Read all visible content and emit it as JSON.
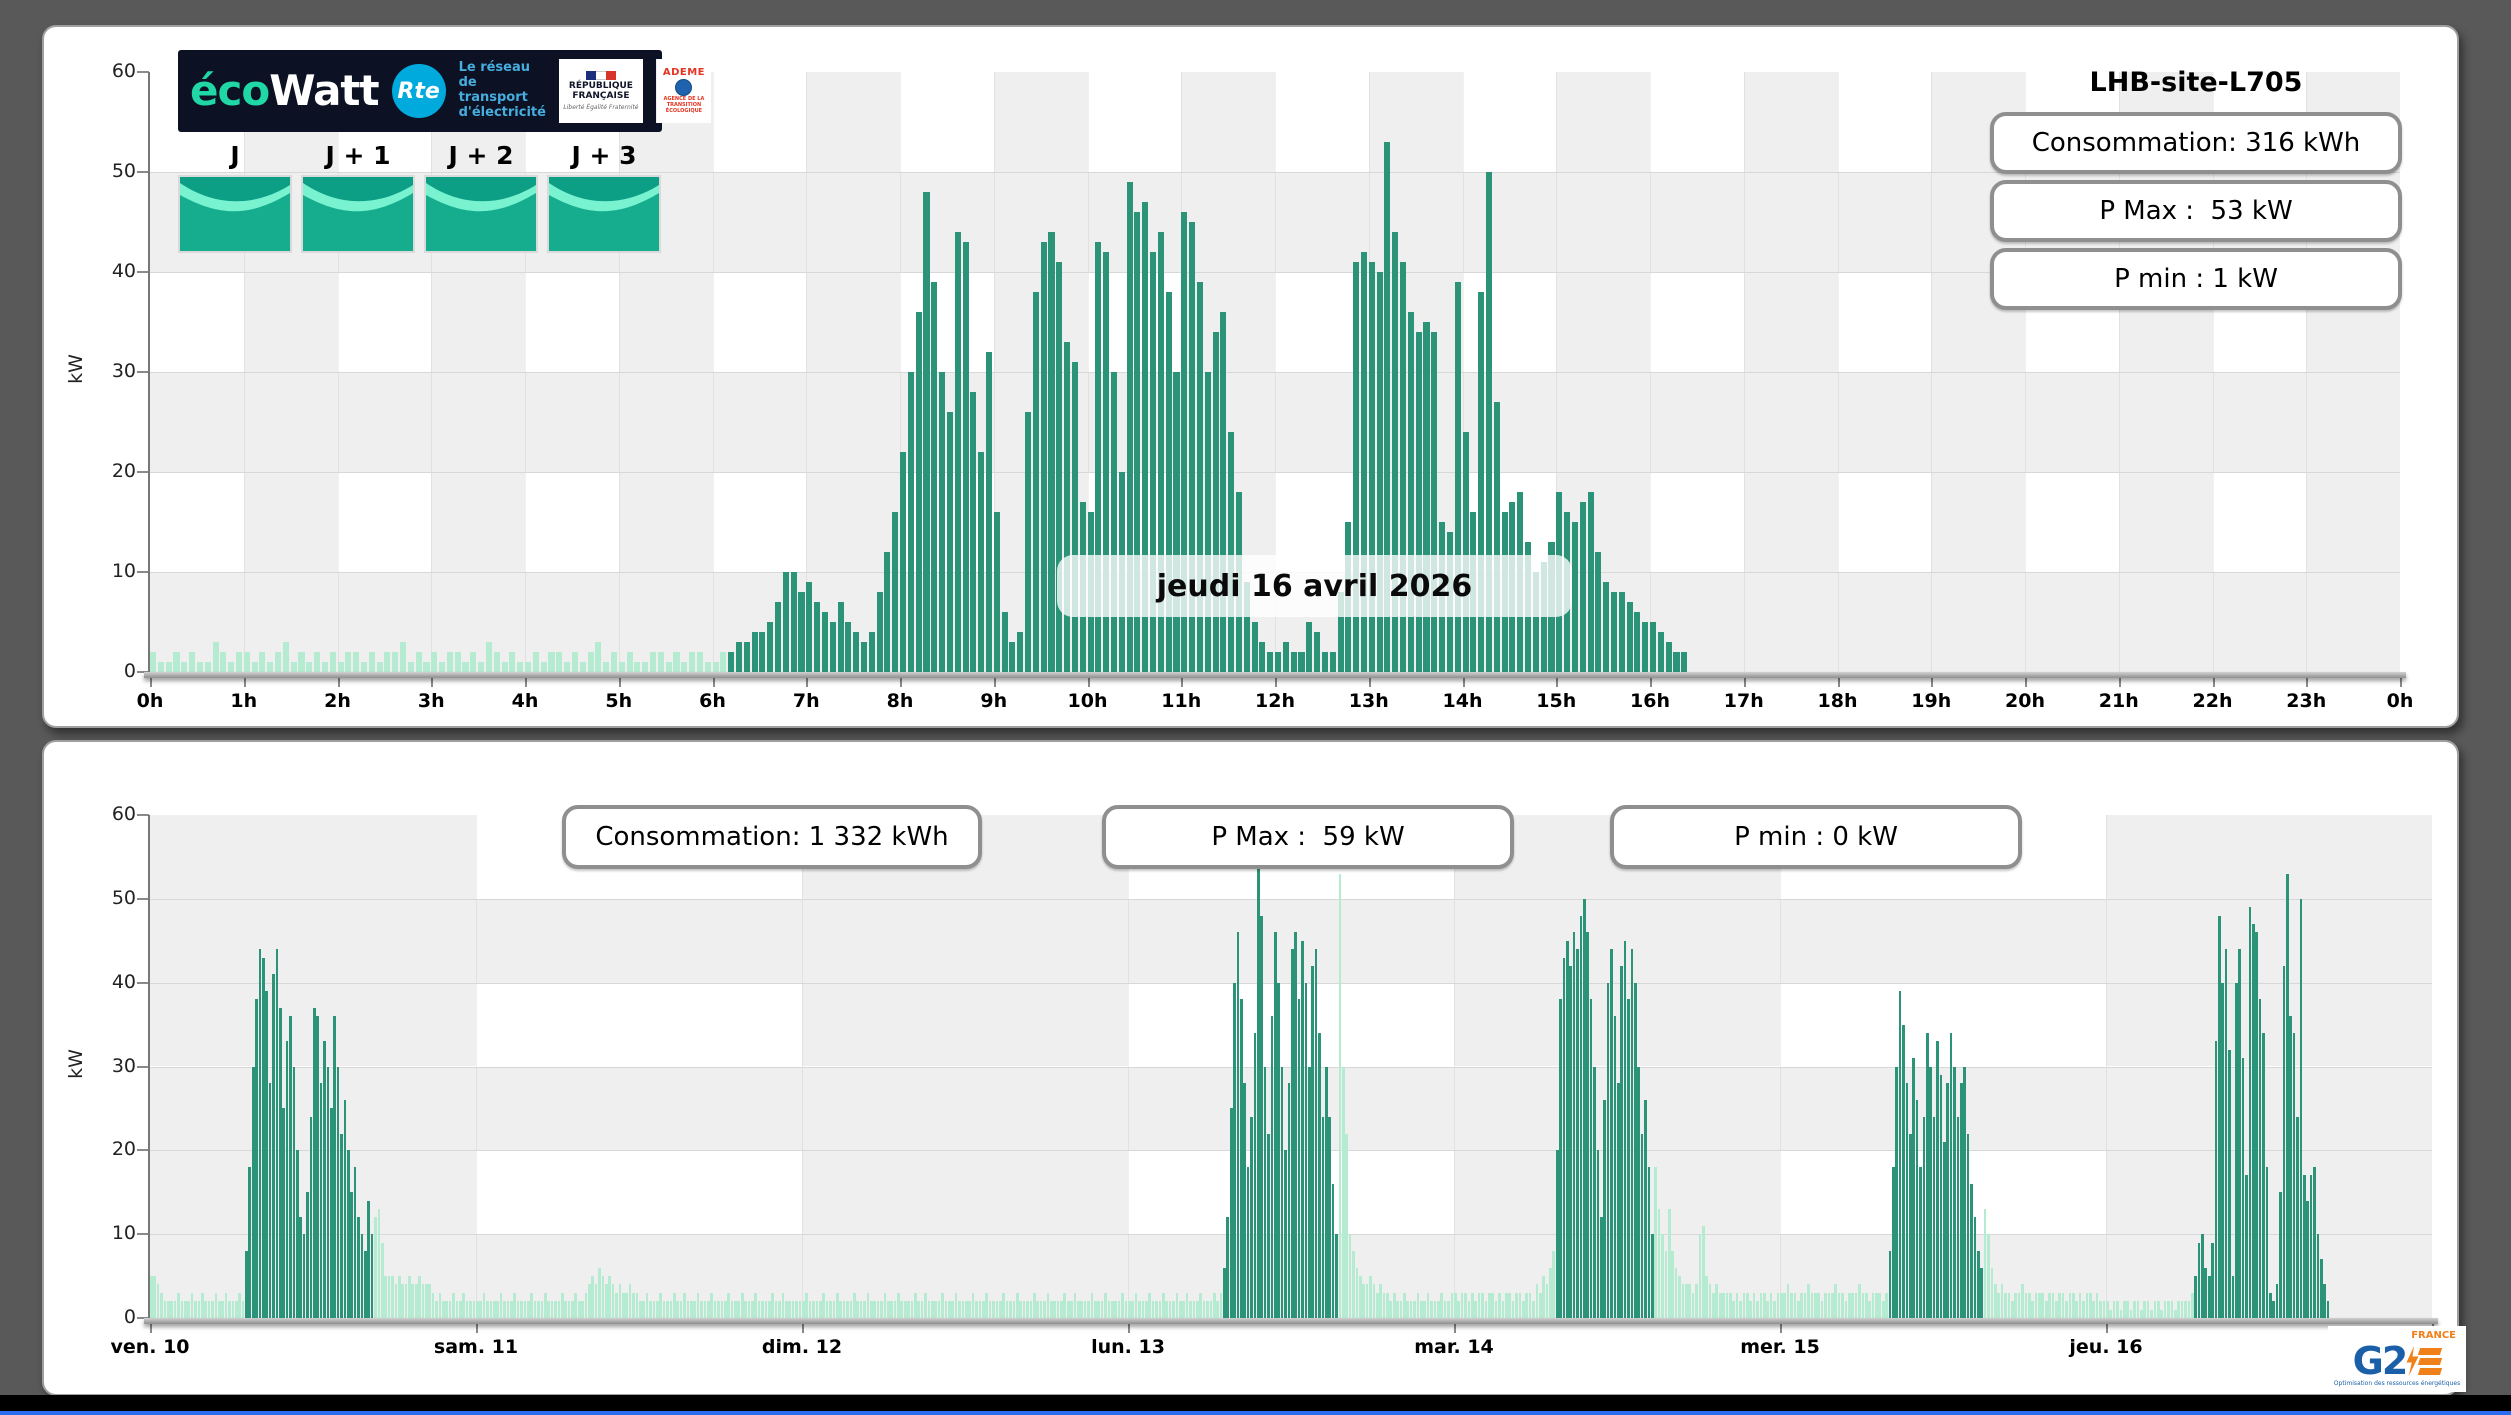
{
  "page": {
    "background": "#595959",
    "taskbar_color": "#000000",
    "taskbar_accent": "#2a6df0"
  },
  "branding": {
    "ecowatt": {
      "eco": "éco",
      "watt": "Watt",
      "bg": "#0d1124",
      "eco_color": "#1fd8a6"
    },
    "rte": {
      "label": "Rte",
      "circle_color": "#00aadc",
      "tagline_lines": [
        "Le réseau",
        "de transport",
        "d'électricité"
      ]
    },
    "republique": {
      "title_lines": [
        "RÉPUBLIQUE",
        "FRANÇAISE"
      ],
      "motto": "Liberté Égalité Fraternité"
    },
    "ademe": {
      "label": "ADEME",
      "sub": "AGENCE DE LA TRANSITION ÉCOLOGIQUE"
    },
    "g2e": {
      "g2": "G2",
      "france": "FRANCE",
      "tagline": "Optimisation des ressources énergétiques",
      "blue": "#1a5fa8",
      "orange": "#f08019"
    }
  },
  "day_selector": {
    "items": [
      {
        "label": "J"
      },
      {
        "label": "J + 1"
      },
      {
        "label": "J + 2"
      },
      {
        "label": "J + 3"
      }
    ],
    "signal_status": "green"
  },
  "top_panel": {
    "title": "LHB-site-L705",
    "stats": [
      {
        "label": "Consommation: 316 kWh"
      },
      {
        "label": "P Max :  53 kW"
      },
      {
        "label": "P min : 1 kW"
      }
    ],
    "date_label": "jeudi 16 avril 2026"
  },
  "bottom_panel": {
    "stats": [
      {
        "label": "Consommation: 1 332 kWh"
      },
      {
        "label": "P Max :  59 kW"
      },
      {
        "label": "P min : 0 kW"
      }
    ]
  },
  "chart_data": [
    {
      "type": "bar",
      "panel": "day",
      "title": "jeudi 16 avril 2026",
      "ylabel": "kW",
      "ylim": [
        0,
        60
      ],
      "yticks": [
        0,
        10,
        20,
        30,
        40,
        50,
        60
      ],
      "xlim_hours": [
        0,
        24
      ],
      "xtick_positions_hours": [
        0,
        1,
        2,
        3,
        4,
        5,
        6,
        7,
        8,
        9,
        10,
        11,
        12,
        13,
        14,
        15,
        16,
        17,
        18,
        19,
        20,
        21,
        22,
        23,
        24
      ],
      "xtick_labels": [
        "0h",
        "1h",
        "2h",
        "3h",
        "4h",
        "5h",
        "6h",
        "7h",
        "8h",
        "9h",
        "10h",
        "11h",
        "12h",
        "13h",
        "14h",
        "15h",
        "16h",
        "17h",
        "18h",
        "19h",
        "20h",
        "21h",
        "22h",
        "23h",
        "0h"
      ],
      "bar_interval_minutes": 5,
      "dark_ranges_hours": [
        [
          6.15,
          16.45
        ]
      ],
      "colors": {
        "dark": "#2b9478",
        "light": "#b4ebd1"
      },
      "grid": {
        "checker_gray": "#efefef",
        "row_height_kw": 10,
        "column_hours": 1,
        "gray_columns": "odd"
      },
      "values": [
        2,
        1,
        1,
        2,
        1,
        2,
        1,
        1,
        3,
        2,
        1,
        2,
        2,
        1,
        2,
        1,
        2,
        3,
        1,
        2,
        1,
        2,
        1,
        2,
        1,
        2,
        2,
        1,
        2,
        1,
        2,
        2,
        3,
        1,
        2,
        1,
        2,
        1,
        2,
        2,
        1,
        2,
        1,
        3,
        2,
        1,
        2,
        1,
        1,
        2,
        1,
        2,
        2,
        1,
        2,
        1,
        2,
        3,
        1,
        2,
        1,
        2,
        1,
        1,
        2,
        2,
        1,
        2,
        1,
        2,
        2,
        1,
        1,
        2,
        2,
        3,
        3,
        4,
        4,
        5,
        7,
        10,
        10,
        8,
        9,
        7,
        6,
        5,
        7,
        5,
        4,
        3,
        4,
        8,
        12,
        16,
        22,
        30,
        36,
        48,
        39,
        30,
        26,
        44,
        43,
        28,
        22,
        32,
        16,
        6,
        3,
        4,
        26,
        38,
        43,
        44,
        41,
        33,
        31,
        17,
        16,
        43,
        42,
        30,
        20,
        49,
        46,
        47,
        42,
        44,
        38,
        30,
        46,
        45,
        39,
        30,
        34,
        36,
        24,
        18,
        9,
        5,
        3,
        2,
        2,
        3,
        2,
        2,
        5,
        4,
        2,
        2,
        8,
        15,
        41,
        42,
        41,
        40,
        53,
        44,
        41,
        36,
        34,
        35,
        34,
        15,
        14,
        39,
        24,
        16,
        38,
        50,
        27,
        16,
        17,
        18,
        13,
        10,
        11,
        13,
        18,
        16,
        15,
        17,
        18,
        12,
        9,
        8,
        8,
        7,
        6,
        5,
        5,
        4,
        3,
        2,
        2
      ]
    },
    {
      "type": "bar",
      "panel": "week",
      "ylabel": "kW",
      "ylim": [
        0,
        60
      ],
      "yticks": [
        0,
        10,
        20,
        30,
        40,
        50,
        60
      ],
      "xlim_hours": [
        0,
        168
      ],
      "xtick_positions_hours": [
        0,
        24,
        48,
        72,
        96,
        120,
        144,
        168
      ],
      "xtick_labels": [
        "ven. 10",
        "sam. 11",
        "dim. 12",
        "lun. 13",
        "mar. 14",
        "mer. 15",
        "jeu. 16",
        null
      ],
      "bar_interval_minutes": 15,
      "dark_ranges_hours": [
        [
          7.0,
          16.5
        ],
        [
          79.0,
          87.5
        ],
        [
          103.5,
          110.75
        ],
        [
          128.0,
          135.0
        ],
        [
          150.5,
          160.5
        ]
      ],
      "colors": {
        "dark": "#2b9478",
        "light": "#b4ebd1"
      },
      "grid": {
        "checker_gray": "#efefef",
        "row_height_kw": 10,
        "column_hours": 24,
        "gray_columns": "even"
      },
      "values": [
        5,
        5,
        4,
        3,
        2,
        2,
        2,
        2,
        3,
        2,
        2,
        2,
        3,
        2,
        2,
        3,
        2,
        2,
        2,
        3,
        2,
        2,
        3,
        2,
        2,
        2,
        3,
        2,
        8,
        18,
        30,
        38,
        44,
        43,
        39,
        28,
        41,
        44,
        37,
        25,
        33,
        36,
        30,
        20,
        12,
        10,
        15,
        24,
        37,
        36,
        28,
        33,
        30,
        25,
        36,
        30,
        22,
        26,
        20,
        15,
        18,
        12,
        10,
        8,
        14,
        10,
        12,
        13,
        9,
        5,
        5,
        5,
        4,
        5,
        4,
        4,
        5,
        4,
        4,
        5,
        4,
        4,
        4,
        3,
        2,
        3,
        2,
        2,
        2,
        3,
        2,
        2,
        3,
        2,
        2,
        2,
        2,
        2,
        3,
        2,
        2,
        2,
        2,
        3,
        2,
        2,
        2,
        3,
        2,
        2,
        2,
        2,
        3,
        2,
        2,
        2,
        3,
        2,
        2,
        2,
        2,
        3,
        2,
        2,
        2,
        3,
        2,
        2,
        3,
        4,
        5,
        4,
        6,
        5,
        4,
        5,
        4,
        3,
        4,
        3,
        3,
        4,
        3,
        3,
        2,
        2,
        3,
        2,
        2,
        2,
        3,
        2,
        2,
        2,
        3,
        2,
        2,
        3,
        2,
        2,
        2,
        3,
        2,
        2,
        2,
        3,
        2,
        2,
        2,
        2,
        3,
        2,
        2,
        2,
        3,
        2,
        2,
        2,
        3,
        2,
        2,
        2,
        2,
        3,
        2,
        2,
        3,
        2,
        2,
        2,
        2,
        2,
        2,
        3,
        2,
        2,
        2,
        2,
        3,
        2,
        2,
        2,
        3,
        2,
        2,
        2,
        2,
        3,
        2,
        2,
        2,
        3,
        2,
        2,
        2,
        2,
        3,
        2,
        2,
        2,
        3,
        2,
        2,
        2,
        2,
        3,
        2,
        2,
        3,
        2,
        2,
        2,
        2,
        3,
        2,
        2,
        2,
        3,
        2,
        2,
        2,
        2,
        3,
        2,
        2,
        2,
        3,
        2,
        2,
        2,
        2,
        3,
        2,
        2,
        2,
        3,
        2,
        2,
        2,
        2,
        3,
        2,
        2,
        2,
        3,
        2,
        2,
        2,
        2,
        3,
        2,
        2,
        3,
        2,
        2,
        2,
        2,
        3,
        2,
        2,
        2,
        3,
        2,
        2,
        2,
        2,
        3,
        2,
        2,
        2,
        3,
        2,
        2,
        2,
        3,
        2,
        2,
        2,
        3,
        2,
        2,
        2,
        3,
        2,
        2,
        3,
        2,
        2,
        2,
        3,
        2,
        2,
        2,
        3,
        2,
        3,
        6,
        12,
        25,
        40,
        46,
        38,
        28,
        18,
        24,
        34,
        59,
        48,
        30,
        22,
        36,
        46,
        40,
        30,
        20,
        28,
        44,
        46,
        38,
        45,
        40,
        30,
        42,
        44,
        34,
        24,
        30,
        24,
        16,
        10,
        53,
        30,
        22,
        10,
        8,
        6,
        5,
        4,
        4,
        5,
        4,
        3,
        4,
        3,
        3,
        2,
        3,
        2,
        2,
        3,
        2,
        2,
        2,
        3,
        2,
        2,
        3,
        2,
        2,
        2,
        3,
        2,
        2,
        3,
        3,
        2,
        3,
        3,
        2,
        3,
        2,
        3,
        3,
        2,
        3,
        3,
        2,
        3,
        2,
        3,
        3,
        2,
        3,
        3,
        2,
        3,
        3,
        2,
        4,
        3,
        5,
        4,
        6,
        8,
        20,
        38,
        43,
        45,
        42,
        46,
        44,
        48,
        50,
        46,
        38,
        30,
        20,
        12,
        26,
        40,
        44,
        36,
        28,
        42,
        45,
        38,
        44,
        40,
        30,
        22,
        26,
        18,
        10,
        18,
        13,
        10,
        8,
        13,
        8,
        6,
        5,
        4,
        4,
        4,
        3,
        4,
        10,
        11,
        5,
        4,
        3,
        4,
        3,
        3,
        3,
        3,
        2,
        3,
        2,
        3,
        3,
        2,
        3,
        2,
        3,
        3,
        2,
        3,
        2,
        3,
        3,
        3,
        4,
        3,
        3,
        2,
        3,
        3,
        4,
        3,
        3,
        3,
        2,
        3,
        3,
        3,
        4,
        3,
        3,
        2,
        3,
        3,
        3,
        4,
        3,
        3,
        2,
        3,
        3,
        3,
        2,
        3,
        8,
        18,
        30,
        39,
        35,
        28,
        22,
        31,
        26,
        18,
        24,
        34,
        30,
        24,
        33,
        29,
        21,
        28,
        34,
        30,
        24,
        28,
        30,
        22,
        16,
        12,
        8,
        6,
        13,
        10,
        6,
        4,
        3,
        4,
        3,
        3,
        2,
        3,
        3,
        4,
        3,
        3,
        2,
        3,
        3,
        3,
        2,
        3,
        3,
        2,
        3,
        3,
        2,
        3,
        3,
        2,
        3,
        2,
        3,
        3,
        2,
        3,
        2,
        2,
        2,
        1,
        2,
        2,
        1,
        2,
        2,
        1,
        2,
        2,
        1,
        2,
        2,
        1,
        2,
        2,
        1,
        2,
        2,
        2,
        1,
        2,
        2,
        2,
        2,
        3,
        5,
        9,
        10,
        6,
        5,
        9,
        33,
        48,
        40,
        44,
        32,
        5,
        40,
        44,
        31,
        17,
        49,
        47,
        46,
        38,
        34,
        18,
        3,
        2,
        4,
        15,
        42,
        53,
        36,
        34,
        24,
        50,
        17,
        14,
        17,
        18,
        10,
        7,
        4,
        2
      ]
    }
  ]
}
